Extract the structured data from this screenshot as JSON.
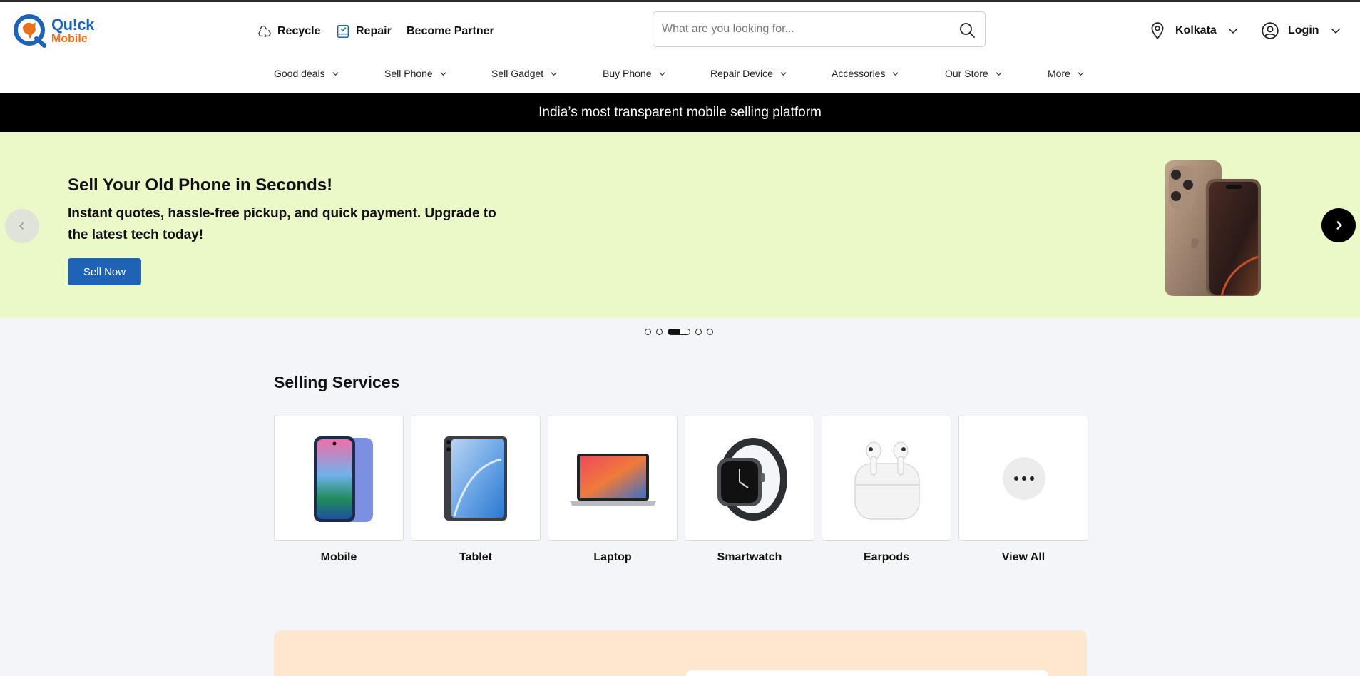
{
  "brand": {
    "name_line1": "Qu!ck",
    "name_line2": "Mobile",
    "color_primary": "#1e63b5",
    "color_accent": "#e8701e"
  },
  "top_nav": {
    "recycle": "Recycle",
    "repair": "Repair",
    "partner": "Become Partner"
  },
  "search": {
    "placeholder": "What are you looking for...",
    "icon": "search-icon"
  },
  "location": {
    "city": "Kolkata",
    "icon": "map-pin-icon"
  },
  "account": {
    "label": "Login",
    "icon": "user-circle-icon"
  },
  "categories": [
    {
      "label": "Good deals"
    },
    {
      "label": "Sell Phone"
    },
    {
      "label": "Sell Gadget"
    },
    {
      "label": "Buy Phone"
    },
    {
      "label": "Repair Device"
    },
    {
      "label": "Accessories"
    },
    {
      "label": "Our Store"
    },
    {
      "label": "More"
    }
  ],
  "announcement": "India’s most transparent mobile selling platform",
  "hero": {
    "title": "Sell Your Old Phone in Seconds!",
    "subtitle": "Instant quotes, hassle-free pickup, and quick payment. Upgrade to the latest tech today!",
    "cta": "Sell Now",
    "background": "#ebf9c9",
    "slide_count": 5,
    "active_slide": 3
  },
  "selling_services": {
    "title": "Selling Services",
    "items": [
      {
        "label": "Mobile",
        "icon": "mobile-phone-icon"
      },
      {
        "label": "Tablet",
        "icon": "tablet-icon"
      },
      {
        "label": "Laptop",
        "icon": "laptop-icon"
      },
      {
        "label": "Smartwatch",
        "icon": "smartwatch-icon"
      },
      {
        "label": "Earpods",
        "icon": "earpods-icon"
      },
      {
        "label": "View All",
        "icon": "more-dots-icon"
      }
    ]
  }
}
